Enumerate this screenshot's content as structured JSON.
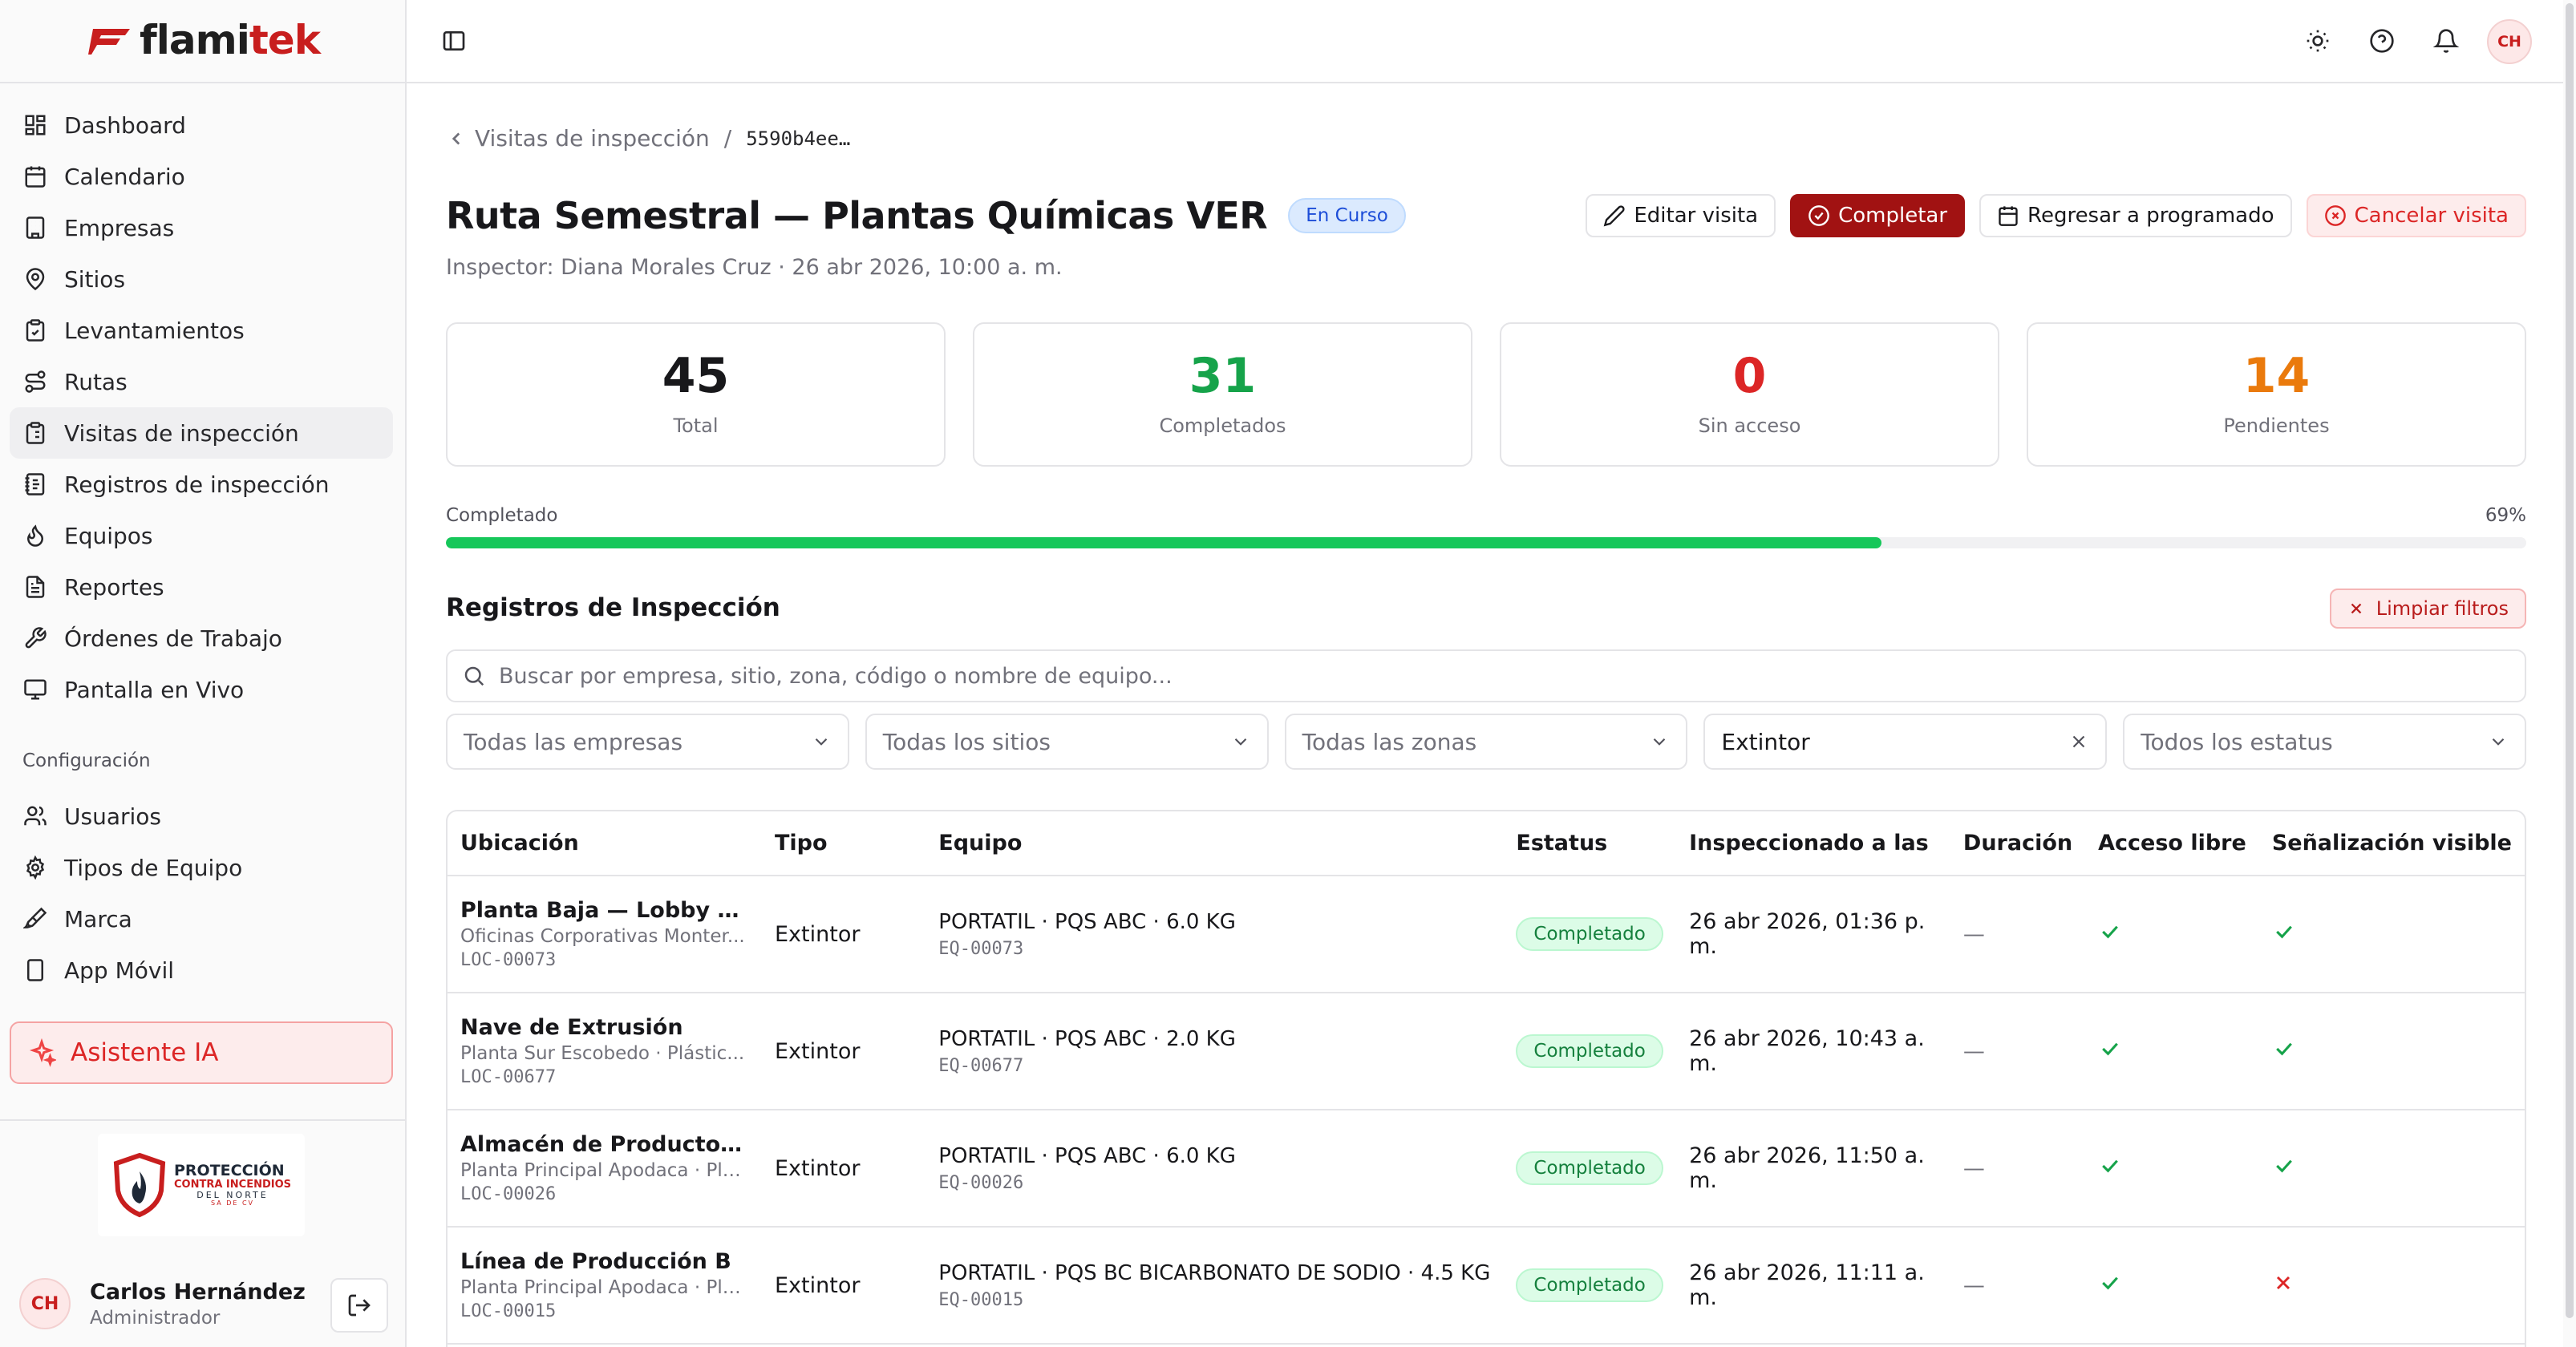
{
  "brand": {
    "logo_text_a": "flami",
    "logo_text_b": "tek",
    "brand_color": "#c81e1e"
  },
  "sidebar": {
    "items": [
      {
        "label": "Dashboard",
        "icon": "dashboard-icon"
      },
      {
        "label": "Calendario",
        "icon": "calendar-icon"
      },
      {
        "label": "Empresas",
        "icon": "building-icon"
      },
      {
        "label": "Sitios",
        "icon": "map-pin-icon"
      },
      {
        "label": "Levantamientos",
        "icon": "clipboard-check-icon"
      },
      {
        "label": "Rutas",
        "icon": "route-icon"
      },
      {
        "label": "Visitas de inspección",
        "icon": "clipboard-list-icon",
        "active": true
      },
      {
        "label": "Registros de inspección",
        "icon": "notebook-icon"
      },
      {
        "label": "Equipos",
        "icon": "flame-icon"
      },
      {
        "label": "Reportes",
        "icon": "file-text-icon"
      },
      {
        "label": "Órdenes de Trabajo",
        "icon": "wrench-icon"
      },
      {
        "label": "Pantalla en Vivo",
        "icon": "monitor-icon"
      }
    ],
    "config_section": "Configuración",
    "config_items": [
      {
        "label": "Usuarios",
        "icon": "users-icon"
      },
      {
        "label": "Tipos de Equipo",
        "icon": "settings-icon"
      },
      {
        "label": "Marca",
        "icon": "brush-icon"
      },
      {
        "label": "App Móvil",
        "icon": "smartphone-icon"
      }
    ],
    "ai_button": "Asistente IA",
    "company_logo_text": [
      "PROTECCIÓN",
      "CONTRA INCENDIOS",
      "DEL NORTE",
      "SA DE CV"
    ],
    "user": {
      "initials": "CH",
      "name": "Carlos Hernández ...",
      "role": "Administrador"
    }
  },
  "topbar": {
    "avatar_initials": "CH"
  },
  "breadcrumb": {
    "parent": "Visitas de inspección",
    "separator": "/",
    "current": "5590b4ee…"
  },
  "header": {
    "title": "Ruta Semestral — Plantas Químicas VER",
    "status": "En Curso",
    "subtitle": "Inspector: Diana Morales Cruz · 26 abr 2026, 10:00 a. m."
  },
  "actions": {
    "edit": "Editar visita",
    "complete": "Completar",
    "back_scheduled": "Regresar a programado",
    "cancel": "Cancelar visita"
  },
  "stats": [
    {
      "value": "45",
      "label": "Total",
      "color": "#18181b"
    },
    {
      "value": "31",
      "label": "Completados",
      "color": "#16a34a"
    },
    {
      "value": "0",
      "label": "Sin acceso",
      "color": "#dc2626"
    },
    {
      "value": "14",
      "label": "Pendientes",
      "color": "#ea7a0c"
    }
  ],
  "progress": {
    "label": "Completado",
    "percent_text": "69%",
    "fraction": 0.69
  },
  "records": {
    "title": "Registros de Inspección",
    "clear_filters": "Limpiar filtros",
    "search_placeholder": "Buscar por empresa, sitio, zona, código o nombre de equipo...",
    "filters": {
      "empresa": "Todas las empresas",
      "sitio": "Todas los sitios",
      "zona": "Todas las zonas",
      "tipo": "Extintor",
      "estatus": "Todos los estatus"
    },
    "columns": [
      "Ubicación",
      "Tipo",
      "Equipo",
      "Estatus",
      "Inspeccionado a las",
      "Duración",
      "Acceso libre",
      "Señalización visible"
    ],
    "rows": [
      {
        "loc": "Planta Baja — Lobby y R...",
        "sub": "Oficinas Corporativas Monter...",
        "code": "LOC-00073",
        "tipo": "Extintor",
        "equipo": "PORTATIL · PQS ABC · 6.0 KG",
        "eq_code": "EQ-00073",
        "estatus": "Completado",
        "time": "26 abr 2026, 01:36 p. m.",
        "dur": "—",
        "acceso": true,
        "senal": true
      },
      {
        "loc": "Nave de Extrusión",
        "sub": "Planta Sur Escobedo · Plástic...",
        "code": "LOC-00677",
        "tipo": "Extintor",
        "equipo": "PORTATIL · PQS ABC · 2.0 KG",
        "eq_code": "EQ-00677",
        "estatus": "Completado",
        "time": "26 abr 2026, 10:43 a. m.",
        "dur": "—",
        "acceso": true,
        "senal": true
      },
      {
        "loc": "Almacén de Producto Ter...",
        "sub": "Planta Principal Apodaca · Plá...",
        "code": "LOC-00026",
        "tipo": "Extintor",
        "equipo": "PORTATIL · PQS ABC · 6.0 KG",
        "eq_code": "EQ-00026",
        "estatus": "Completado",
        "time": "26 abr 2026, 11:50 a. m.",
        "dur": "—",
        "acceso": true,
        "senal": true
      },
      {
        "loc": "Línea de Producción B",
        "sub": "Planta Principal Apodaca · Plá...",
        "code": "LOC-00015",
        "tipo": "Extintor",
        "equipo": "PORTATIL · PQS BC BICARBONATO DE SODIO · 4.5 KG",
        "eq_code": "EQ-00015",
        "estatus": "Completado",
        "time": "26 abr 2026, 11:11 a. m.",
        "dur": "—",
        "acceso": true,
        "senal": false
      }
    ]
  }
}
